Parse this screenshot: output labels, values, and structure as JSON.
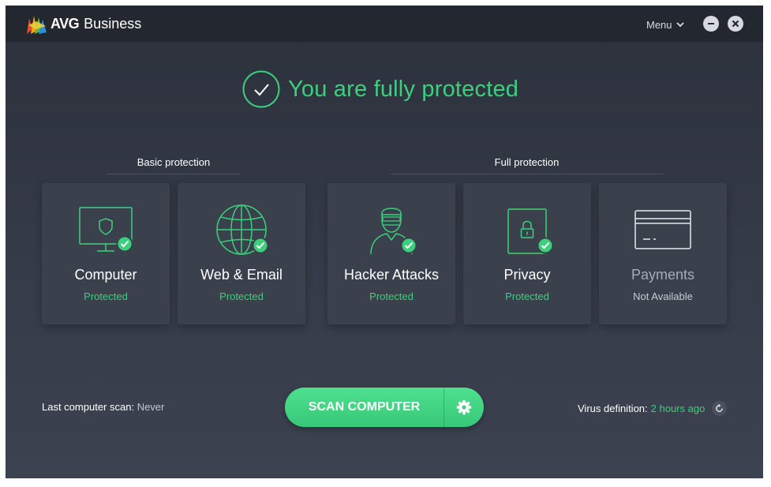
{
  "header": {
    "brand": "AVG",
    "product": "Business",
    "menu_label": "Menu"
  },
  "status": {
    "headline": "You are fully protected"
  },
  "sections": {
    "basic": "Basic protection",
    "full": "Full protection"
  },
  "cards": [
    {
      "title": "Computer",
      "status": "Protected",
      "icon": "monitor-shield-icon"
    },
    {
      "title": "Web & Email",
      "status": "Protected",
      "icon": "globe-icon"
    },
    {
      "title": "Hacker Attacks",
      "status": "Protected",
      "icon": "hacker-icon"
    },
    {
      "title": "Privacy",
      "status": "Protected",
      "icon": "lock-icon"
    },
    {
      "title": "Payments",
      "status": "Not Available",
      "icon": "credit-card-icon"
    }
  ],
  "footer": {
    "last_scan_label": "Last computer scan:",
    "last_scan_value": "Never",
    "scan_button": "SCAN COMPUTER",
    "virus_def_label": "Virus definition:",
    "virus_def_value": "2 hours ago"
  },
  "colors": {
    "accent_green": "#3ccf7c",
    "background": "#2f3440",
    "card": "#3a404c"
  }
}
